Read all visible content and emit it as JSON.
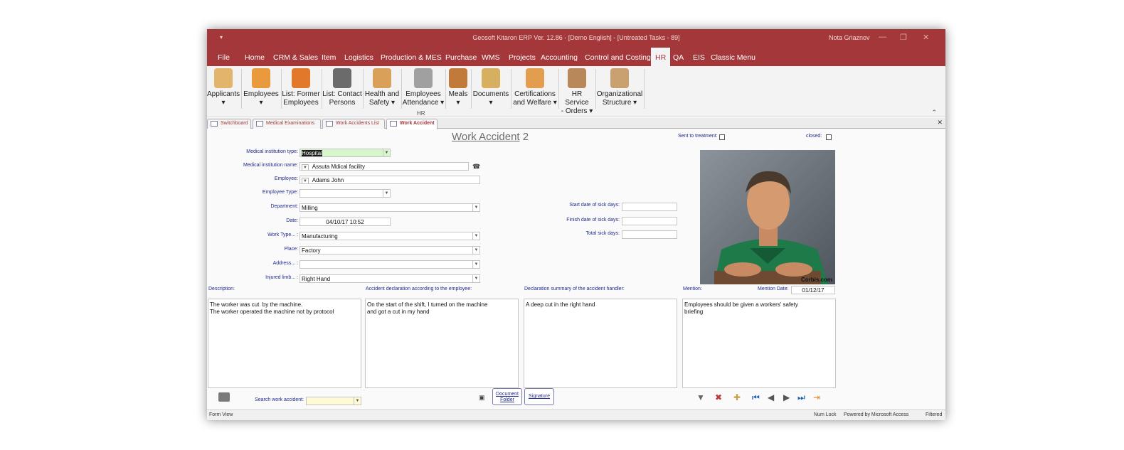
{
  "window": {
    "title": "Geosoft Kitaron ERP Ver. 12.86 - [Demo English] - [Untreated Tasks - 89]",
    "user": "Nota Griaznov",
    "qat_glyph": "▾",
    "controls": [
      "—",
      "❐",
      "✕"
    ]
  },
  "menu": {
    "tabs": [
      "File",
      "Home",
      "CRM & Sales",
      "Item",
      "Logistics",
      "Production & MES",
      "Purchase",
      "WMS",
      "Projects",
      "Accounting",
      "Control and Costing",
      "HR",
      "QA",
      "EIS",
      "Classic Menu"
    ],
    "active": "HR"
  },
  "ribbon": {
    "group_label": "HR",
    "buttons": [
      {
        "line1": "Applicants",
        "line2": "▾",
        "color": "#e3b46b"
      },
      {
        "line1": "Employees",
        "line2": "▾",
        "color": "#e89a3c"
      },
      {
        "line1": "List: Former",
        "line2": "Employees",
        "color": "#e07a2a"
      },
      {
        "line1": "List: Contact",
        "line2": "Persons",
        "color": "#6b6b6b"
      },
      {
        "line1": "Health and",
        "line2": "Safety ▾",
        "color": "#d9a05a"
      },
      {
        "line1": "Employees",
        "line2": "Attendance ▾",
        "color": "#a0a0a0"
      },
      {
        "line1": "Meals",
        "line2": "▾",
        "color": "#c27a3a"
      },
      {
        "line1": "Documents",
        "line2": "▾",
        "color": "#d6b060"
      },
      {
        "line1": "Certifications",
        "line2": "and Welfare ▾",
        "color": "#e29d4f"
      },
      {
        "line1": "HR Service",
        "line2": "- Orders ▾",
        "color": "#b9885a"
      },
      {
        "line1": "Organizational",
        "line2": "Structure ▾",
        "color": "#c9a070"
      }
    ],
    "collapse_glyph": "⌃"
  },
  "doc_tabs": {
    "items": [
      "Switchboard",
      "Medical Examinations",
      "Work Accidents List",
      "Work Accident"
    ],
    "active": "Work Accident",
    "close_glyph": "✕"
  },
  "form": {
    "title": "Work Accident",
    "number": "2",
    "sent_to_treatment_label": "Sent to treatment:",
    "closed_label": "closed:",
    "fields": {
      "medical_institution_type": {
        "label": "Medical institution type:",
        "value": "Hospital"
      },
      "medical_institution_name": {
        "label": "Medical institution name:",
        "value": "Assuta Mdical facility"
      },
      "employee": {
        "label": "Employee:",
        "value": "Adams John"
      },
      "employee_type": {
        "label": "Employee Type:",
        "value": ""
      },
      "department": {
        "label": "Department:",
        "value": "Milling"
      },
      "date": {
        "label": "Date:",
        "value": "04/10/17 10:52"
      },
      "work_type": {
        "label": "Work Type... :",
        "value": "Manufacturing"
      },
      "place": {
        "label": "Place:",
        "value": "Factory"
      },
      "address": {
        "label": "Address... :",
        "value": ""
      },
      "injured_limb": {
        "label": "Injured limb... :",
        "value": "Right Hand"
      },
      "start_sick": {
        "label": "Start date of sick days:",
        "value": ""
      },
      "finish_sick": {
        "label": "Finish date of sick days:",
        "value": ""
      },
      "total_sick": {
        "label": "Total sick days:",
        "value": ""
      }
    },
    "photo_credit": "Corbis.com",
    "description": {
      "label": "Description:",
      "value": "The worker was cut  by the machine.\nThe worker operated the machine not by protocol"
    },
    "declaration": {
      "label": "Accident declaration according to the employee:",
      "value": "On the start of the shift, I turned on the machine\nand got a cut in my hand"
    },
    "summary": {
      "label": "Declaration summary of the accident handler:",
      "value": "A deep cut in the right hand"
    },
    "mention": {
      "label": "Mention:",
      "value": "Employees should be given a workers' safety\nbriefing"
    },
    "mention_date": {
      "label": "Mention Date:",
      "value": "01/12/17"
    },
    "search_label": "Search work accident:",
    "document_folder_label": "Document\nFolder",
    "signature_label": "Signature"
  },
  "status": {
    "left": "Form View",
    "num_lock": "Num Lock",
    "powered": "Powered by Microsoft Access",
    "filtered": "Filtered"
  }
}
